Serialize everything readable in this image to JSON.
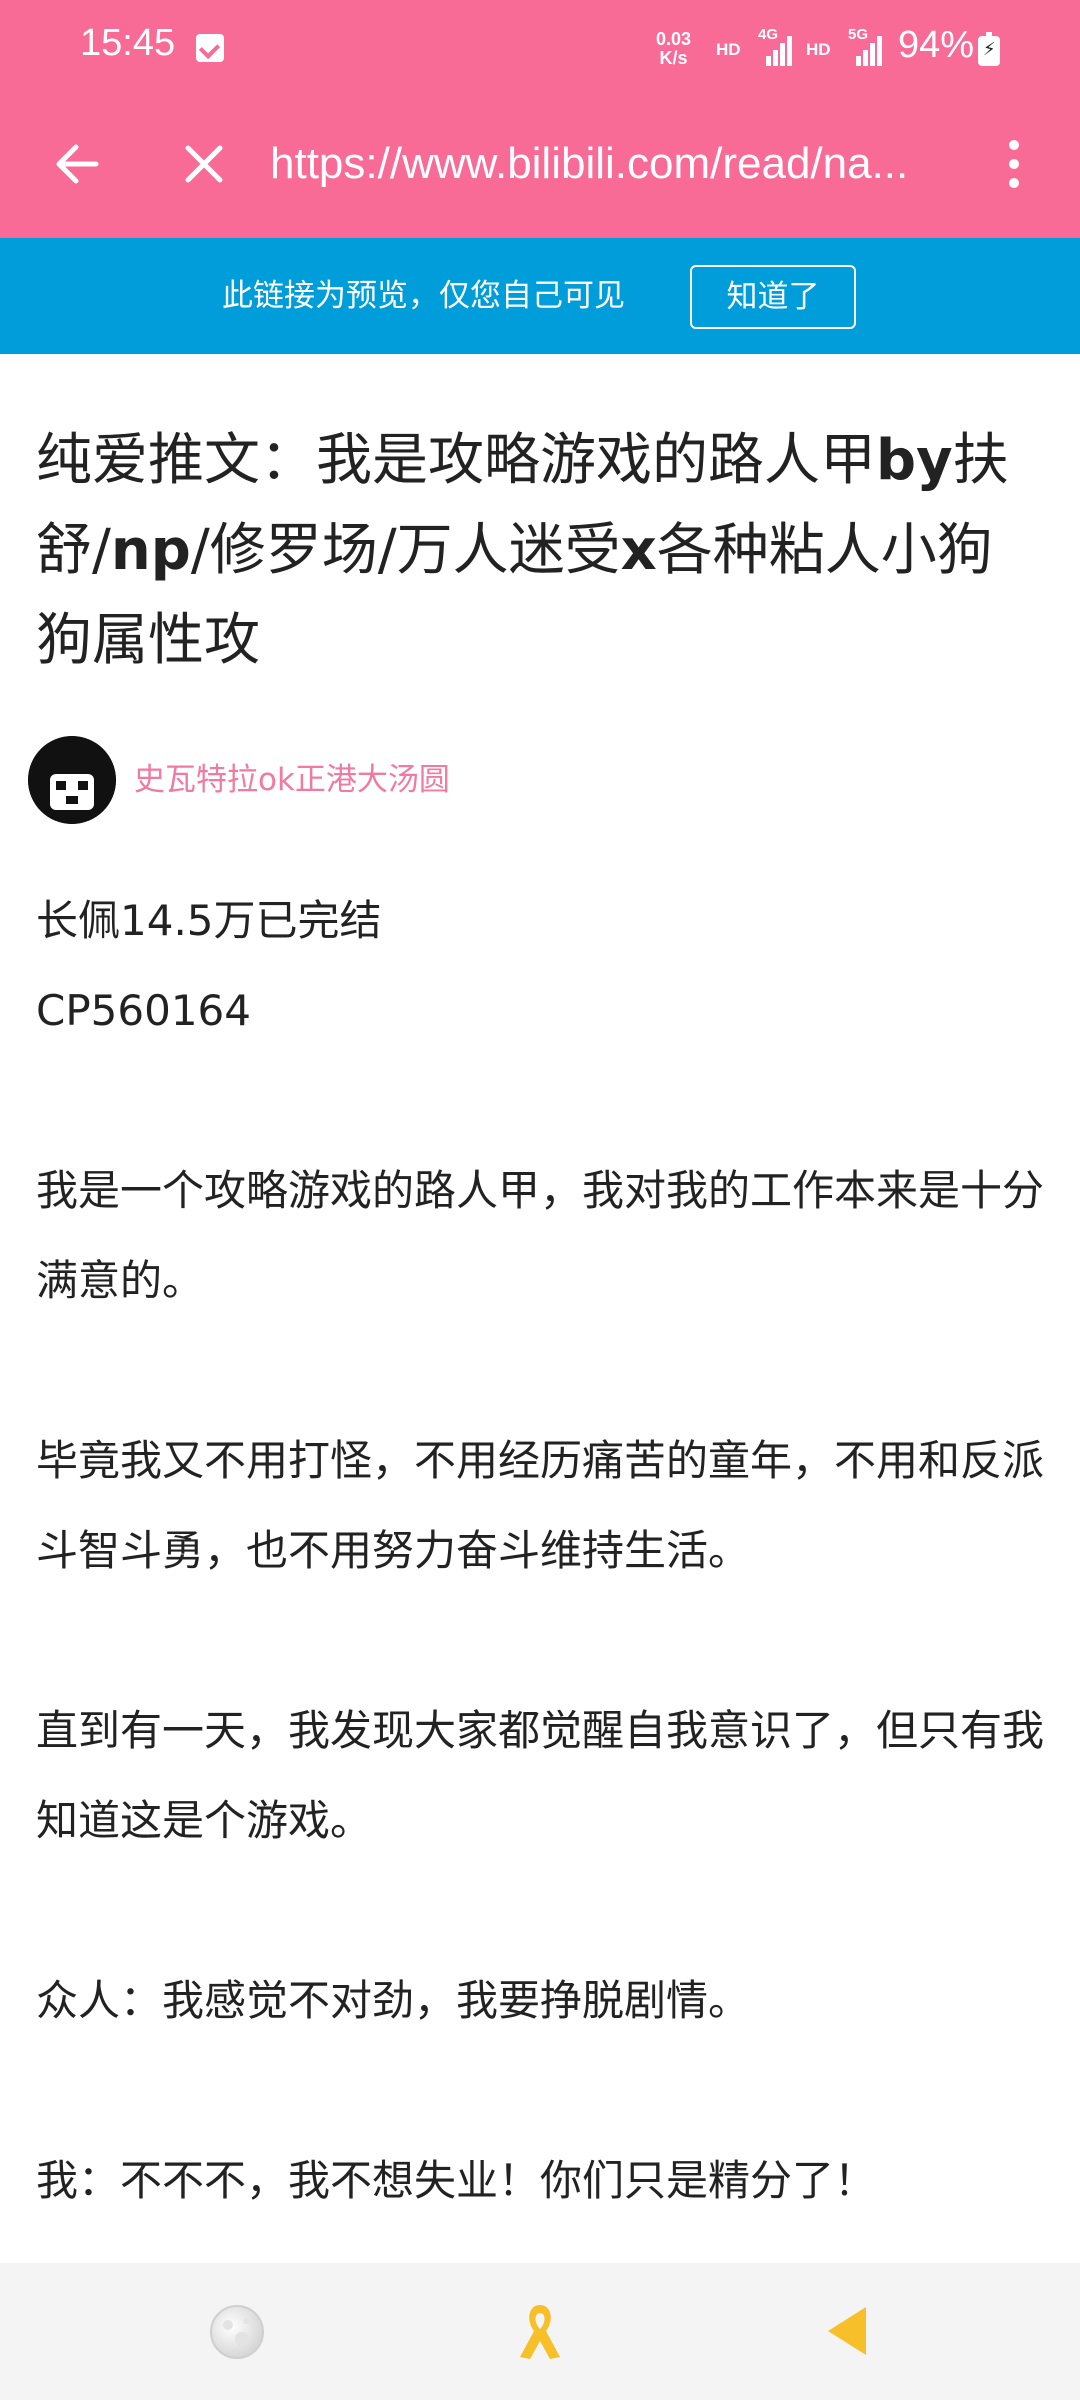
{
  "status_bar": {
    "time": "15:45",
    "net_speed_value": "0.03",
    "net_speed_unit": "K/s",
    "hd1": "HD",
    "sig1_tag": "4G",
    "hd2": "HD",
    "sig2_tag": "5G",
    "battery": "94%"
  },
  "nav": {
    "url": "https://www.bilibili.com/read/na..."
  },
  "banner": {
    "text": "此链接为预览，仅您自己可见",
    "button": "知道了"
  },
  "article": {
    "title_part1": "纯爱推文：我是攻略游戏的路人甲",
    "title_part2": "by",
    "title_part3": "扶舒/",
    "title_part4": "np",
    "title_part5": "/修罗场/万人迷受",
    "title_part6": "x",
    "title_part7": "各种粘人小狗狗属性攻",
    "author": "史瓦特拉ok正港大汤圆",
    "paragraphs": [
      "长佩14.5万已完结",
      "CP560164",
      "我是一个攻略游戏的路人甲，我对我的工作本来是十分满意的。",
      "毕竟我又不用打怪，不用经历痛苦的童年，不用和反派斗智斗勇，也不用努力奋斗维持生活。",
      "直到有一天，我发现大家都觉醒自我意识了，但只有我知道这是个游戏。",
      "众人：我感觉不对劲，我要挣脱剧情。",
      "我：不不不，我不想失业！你们只是精分了！"
    ]
  },
  "colors": {
    "toolbar": "#f96b97",
    "banner": "#009ddb",
    "author": "#f07ba0",
    "ribbon": "#f7c02a",
    "back_triangle": "#f7c02a"
  },
  "icons": {
    "nav_back": "arrow-left-icon",
    "nav_close": "close-icon",
    "menu": "more-vertical-icon",
    "bottom_1": "moon-icon",
    "bottom_2": "ribbon-icon",
    "bottom_3": "triangle-back-icon"
  }
}
